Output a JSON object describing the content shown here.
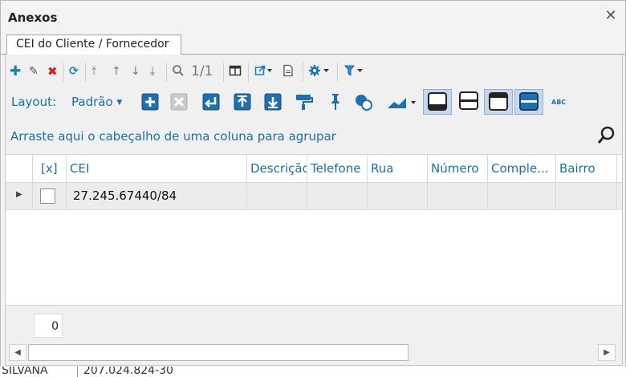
{
  "window": {
    "title": "Anexos",
    "close_glyph": "✕"
  },
  "tabs": [
    {
      "label": "CEI do Cliente /  Fornecedor",
      "active": true
    }
  ],
  "toolbar": {
    "record_nav": "1/1"
  },
  "layout_bar": {
    "label": "Layout:",
    "selected": "Padrão"
  },
  "group_hint": "Arraste aqui o cabeçalho de uma coluna para agrupar",
  "grid": {
    "columns": [
      "[x]",
      "CEI",
      "Descrição",
      "Telefone",
      "Rua",
      "Número",
      "Comple...",
      "Bairro"
    ],
    "rows": [
      {
        "checked": false,
        "cei": "27.245.67440/84"
      }
    ]
  },
  "footer": {
    "count": "0"
  },
  "background_row": {
    "name": "SILVANA",
    "number": "207.024.824-30"
  },
  "colors": {
    "accent": "#1d6fa5",
    "add": "#1a7fc1",
    "delete": "#d22020",
    "active_button": "#c5d8ef"
  }
}
